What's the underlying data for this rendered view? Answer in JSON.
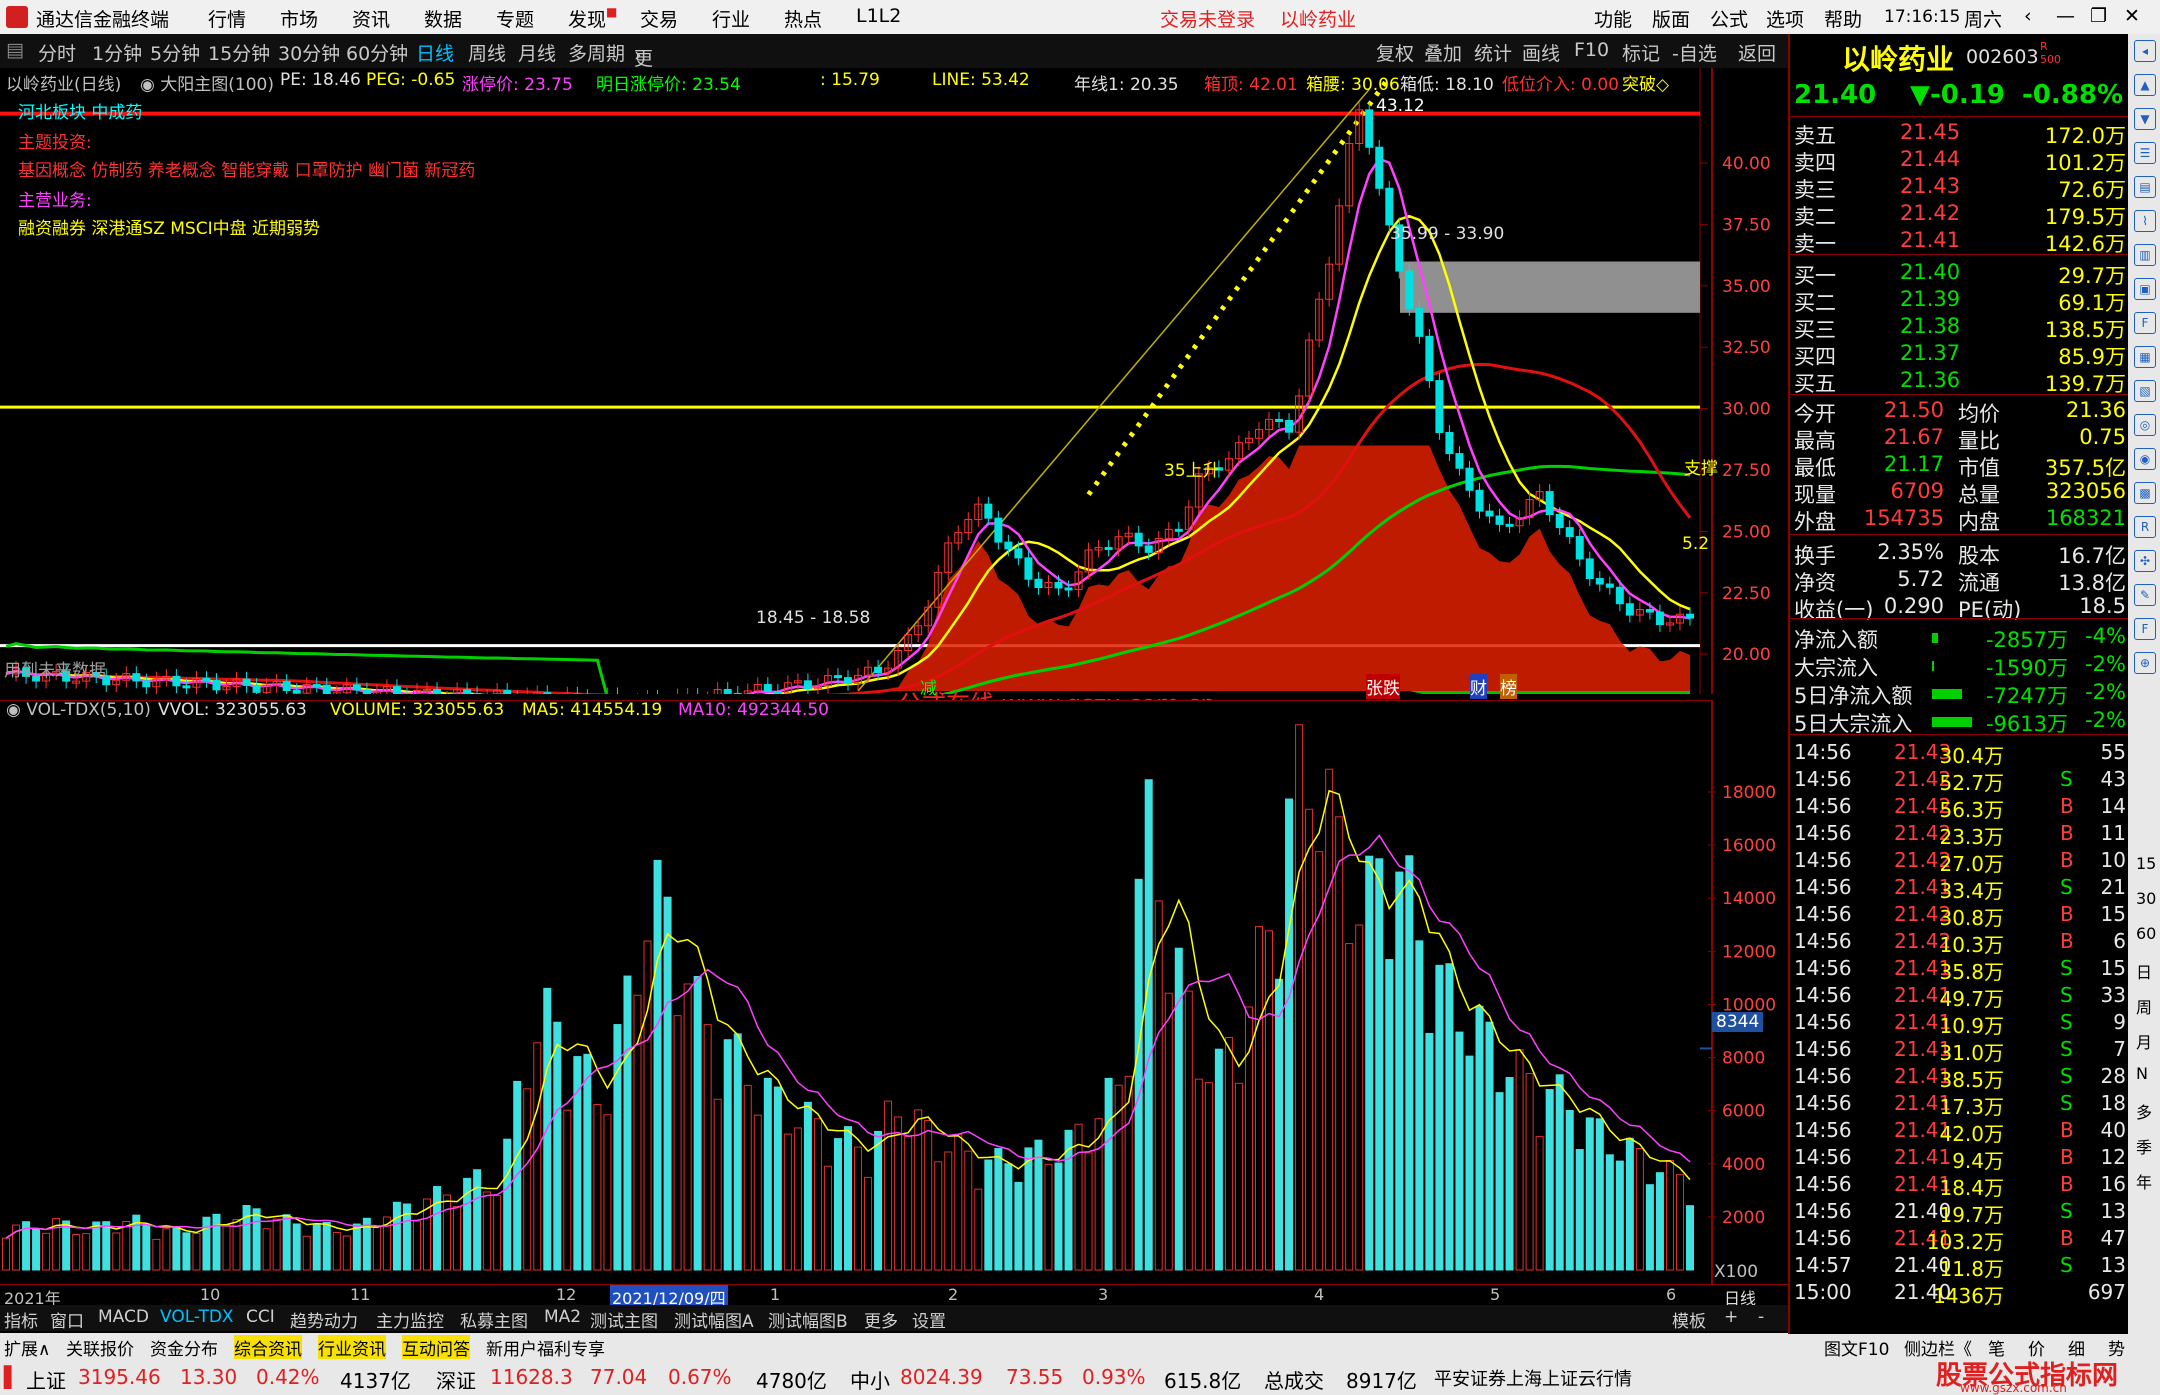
{
  "menubar": {
    "app_title": "通达信金融终端",
    "items": [
      "行情",
      "市场",
      "资讯",
      "数据",
      "专题",
      "发现",
      "交易",
      "行业",
      "热点",
      "L1L2"
    ],
    "status_login": "交易未登录",
    "status_stock": "以岭药业",
    "right_items": [
      "功能",
      "版面",
      "公式",
      "选项",
      "帮助"
    ],
    "time": "17:16:15",
    "weekday": "周六"
  },
  "periodbar": {
    "periods": [
      "分时",
      "1分钟",
      "5分钟",
      "15分钟",
      "30分钟",
      "60分钟",
      "日线",
      "周线",
      "月线",
      "多周期",
      "更多"
    ],
    "active": "日线",
    "buttons": [
      "复权",
      "叠加",
      "统计",
      "画线",
      "F10",
      "标记",
      "-自选",
      "返回"
    ]
  },
  "main_chart": {
    "header": {
      "name": "以岭药业(日线)",
      "indicator": "大阳主图(100)",
      "pe": "PE: 18.46",
      "peg": "PEG: -0.65",
      "limit_up": "涨停价: 23.75",
      "next_limit": "明日涨停价: 23.54",
      "v1": ": 15.79",
      "line": "LINE: 53.42",
      "year_line": "年线1: 20.35",
      "box_top": "箱顶: 42.01",
      "box_mid": "箱腰: 30.06",
      "box_low": "箱低: 18.10",
      "low_entry": "低位介入: 0.00",
      "breakout": "突破◇"
    },
    "left_text": {
      "sector": "河北板块 中成药",
      "theme_title": "主题投资:",
      "theme": "基因概念 仿制药 养老概念 智能穿戴 口罩防护 幽门菌 新冠药",
      "business_title": "主营业务:",
      "business": "融资融券 深港通SZ MSCI中盘 近期弱势",
      "future": "用到未来数据"
    },
    "annotations": {
      "top_price": "43.12",
      "box_range": "35.99 - 33.90",
      "low_range": "18.45 - 18.58",
      "support": "支撑",
      "last": "5.2",
      "watermark": "公式在线 www.gszx.com.cn",
      "rise1": "35上升",
      "tags": [
        "减",
        "张跌",
        "财",
        "榜"
      ]
    },
    "y_ticks": [
      "40.00",
      "37.50",
      "35.00",
      "32.50",
      "30.00",
      "27.50",
      "25.00",
      "22.50",
      "20.00",
      "17.50",
      "15.00"
    ]
  },
  "vol_chart": {
    "header": {
      "name": "VOL-TDX(5,10)",
      "vvol": "VVOL: 323055.63",
      "volume": "VOLUME: 323055.63",
      "ma5": "MA5: 414554.19",
      "ma10": "MA10: 492344.50"
    },
    "y_ticks": [
      "18000",
      "16000",
      "14000",
      "12000",
      "10000",
      "8000",
      "6000",
      "4000",
      "2000"
    ],
    "marker": "8344",
    "unit": "X100"
  },
  "x_axis": {
    "labels": [
      "2021年",
      "10",
      "11",
      "12",
      "2021/12/09/四",
      "1",
      "2",
      "3",
      "4",
      "5",
      "6"
    ],
    "period_label": "日线"
  },
  "chart_data": [
    {
      "type": "candlestick",
      "title": "以岭药业(日线)",
      "ylim": [
        15,
        42.5
      ],
      "note": "daily candles approx from Sep 2021 to Jun 2022",
      "key_prices": {
        "high": 43.12,
        "box_top": 42.01,
        "box_mid": 30.06,
        "box_low": 18.1,
        "last": 21.4
      }
    },
    {
      "type": "bar",
      "title": "VOL-TDX(5,10)",
      "ylim": [
        0,
        18000
      ],
      "values_sample_x100": [
        1600,
        1500,
        1700,
        1400,
        1600,
        1800,
        1500,
        1300,
        1700,
        1900,
        2100,
        1800,
        1600,
        1500,
        1400,
        1900,
        2200,
        2500,
        2800,
        3200,
        3000,
        8000,
        9000,
        7500,
        6000,
        9000,
        13500,
        12000,
        9000,
        8000,
        7000,
        6000,
        5500,
        5000,
        4500,
        4300,
        6000,
        5000,
        4500,
        4000,
        3800,
        4000,
        4200,
        4500,
        5500,
        6500,
        16000,
        12000,
        8000,
        7000,
        9000,
        12000,
        17000,
        18000,
        14000,
        13000,
        15000,
        12000,
        10000,
        9000,
        8000,
        7000,
        6500,
        6000,
        5000,
        4500,
        4000,
        3500,
        3200
      ]
    }
  ],
  "quote": {
    "name": "以岭药业",
    "code": "002603",
    "price": "21.40",
    "change": "▼-0.19",
    "pct": "-0.88%",
    "asks": [
      {
        "label": "卖五",
        "price": "21.45",
        "vol": "172.0万"
      },
      {
        "label": "卖四",
        "price": "21.44",
        "vol": "101.2万"
      },
      {
        "label": "卖三",
        "price": "21.43",
        "vol": "72.6万"
      },
      {
        "label": "卖二",
        "price": "21.42",
        "vol": "179.5万"
      },
      {
        "label": "卖一",
        "price": "21.41",
        "vol": "142.6万"
      }
    ],
    "bids": [
      {
        "label": "买一",
        "price": "21.40",
        "vol": "29.7万"
      },
      {
        "label": "买二",
        "price": "21.39",
        "vol": "69.1万"
      },
      {
        "label": "买三",
        "price": "21.38",
        "vol": "138.5万"
      },
      {
        "label": "买四",
        "price": "21.37",
        "vol": "85.9万"
      },
      {
        "label": "买五",
        "price": "21.36",
        "vol": "139.7万"
      }
    ],
    "stats": [
      {
        "l1": "今开",
        "v1": "21.50",
        "l2": "均价",
        "v2": "21.36"
      },
      {
        "l1": "最高",
        "v1": "21.67",
        "l2": "量比",
        "v2": "0.75"
      },
      {
        "l1": "最低",
        "v1": "21.17",
        "l2": "市值",
        "v2": "357.5亿"
      },
      {
        "l1": "现量",
        "v1": "6709",
        "l2": "总量",
        "v2": "323056"
      },
      {
        "l1": "外盘",
        "v1": "154735",
        "l2": "内盘",
        "v2": "168321"
      }
    ],
    "stats2": [
      {
        "l1": "换手",
        "v1": "2.35%",
        "l2": "股本",
        "v2": "16.7亿"
      },
      {
        "l1": "净资",
        "v1": "5.72",
        "l2": "流通",
        "v2": "13.8亿"
      },
      {
        "l1": "收益(一)",
        "v1": "0.290",
        "l2": "PE(动)",
        "v2": "18.5"
      }
    ],
    "flows": [
      {
        "label": "净流入额",
        "value": "-2857万",
        "pct": "-4%"
      },
      {
        "label": "大宗流入",
        "value": "-1590万",
        "pct": "-2%"
      },
      {
        "label": "5日净流入额",
        "value": "-7247万",
        "pct": "-2%"
      },
      {
        "label": "5日大宗流入",
        "value": "-9613万",
        "pct": "-2%"
      }
    ],
    "ticks": [
      {
        "t": "14:56",
        "p": "21.43",
        "v": "30.4万",
        "s": "",
        "n": "55"
      },
      {
        "t": "14:56",
        "p": "21.42",
        "v": "52.7万",
        "s": "S",
        "n": "43"
      },
      {
        "t": "14:56",
        "p": "21.42",
        "v": "56.3万",
        "s": "B",
        "n": "14"
      },
      {
        "t": "14:56",
        "p": "21.42",
        "v": "23.3万",
        "s": "B",
        "n": "11"
      },
      {
        "t": "14:56",
        "p": "21.42",
        "v": "27.0万",
        "s": "B",
        "n": "10"
      },
      {
        "t": "14:56",
        "p": "21.41",
        "v": "33.4万",
        "s": "S",
        "n": "21"
      },
      {
        "t": "14:56",
        "p": "21.42",
        "v": "30.8万",
        "s": "B",
        "n": "15"
      },
      {
        "t": "14:56",
        "p": "21.42",
        "v": "10.3万",
        "s": "B",
        "n": "6"
      },
      {
        "t": "14:56",
        "p": "21.41",
        "v": "35.8万",
        "s": "S",
        "n": "15"
      },
      {
        "t": "14:56",
        "p": "21.41",
        "v": "49.7万",
        "s": "S",
        "n": "33"
      },
      {
        "t": "14:56",
        "p": "21.41",
        "v": "10.9万",
        "s": "S",
        "n": "9"
      },
      {
        "t": "14:56",
        "p": "21.41",
        "v": "31.0万",
        "s": "S",
        "n": "7"
      },
      {
        "t": "14:56",
        "p": "21.41",
        "v": "38.5万",
        "s": "S",
        "n": "28"
      },
      {
        "t": "14:56",
        "p": "21.41",
        "v": "17.3万",
        "s": "S",
        "n": "18"
      },
      {
        "t": "14:56",
        "p": "21.41",
        "v": "42.0万",
        "s": "B",
        "n": "40"
      },
      {
        "t": "14:56",
        "p": "21.41",
        "v": "9.4万",
        "s": "B",
        "n": "12"
      },
      {
        "t": "14:56",
        "p": "21.41",
        "v": "18.4万",
        "s": "B",
        "n": "16"
      },
      {
        "t": "14:56",
        "p": "21.40",
        "v": "19.7万",
        "s": "S",
        "n": "13"
      },
      {
        "t": "14:56",
        "p": "21.41",
        "v": "103.2万",
        "s": "B",
        "n": "47"
      },
      {
        "t": "14:57",
        "p": "21.40",
        "v": "11.8万",
        "s": "S",
        "n": "13"
      },
      {
        "t": "15:00",
        "p": "21.40",
        "v": "1436万",
        "s": "",
        "n": "697"
      }
    ]
  },
  "tabs": [
    "指标",
    "窗口",
    "MACD",
    "VOL-TDX",
    "CCI",
    "趋势动力",
    "主力监控",
    "私募主图",
    "MA2",
    "测试主图",
    "测试幅图A",
    "测试幅图B",
    "更多",
    "设置"
  ],
  "tabs_active": "VOL-TDX",
  "tabs_right": [
    "模板",
    "+",
    "-"
  ],
  "tabs2": [
    "扩展∧",
    "关联报价",
    "资金分布",
    "综合资讯",
    "行业资讯",
    "互动问答",
    "新用户福利专享"
  ],
  "rtabs": [
    "图文F10",
    "侧边栏《",
    "笔",
    "价",
    "细",
    "势"
  ],
  "statusbar": {
    "sh": "上证",
    "sh_v": "3195.46",
    "sh_c": "13.30",
    "sh_p": "0.42%",
    "sh_a": "4137亿",
    "sz": "深证",
    "sz_v": "11628.3",
    "sz_c": "77.04",
    "sz_p": "0.67%",
    "sz_a": "4780亿",
    "zx": "中小",
    "zx_v": "8024.39",
    "zx_c": "73.55",
    "zx_p": "0.93%",
    "zx_a": "615.8亿",
    "total": "总成交",
    "total_v": "8917亿",
    "broker": "平安证券上海上证云行情",
    "ad": "股票公式指标网",
    "ad_url": "www.gszx.com.cn"
  },
  "side_labels": [
    "15",
    "30",
    "60",
    "日",
    "周",
    "月",
    "N",
    "多",
    "季",
    "年"
  ]
}
